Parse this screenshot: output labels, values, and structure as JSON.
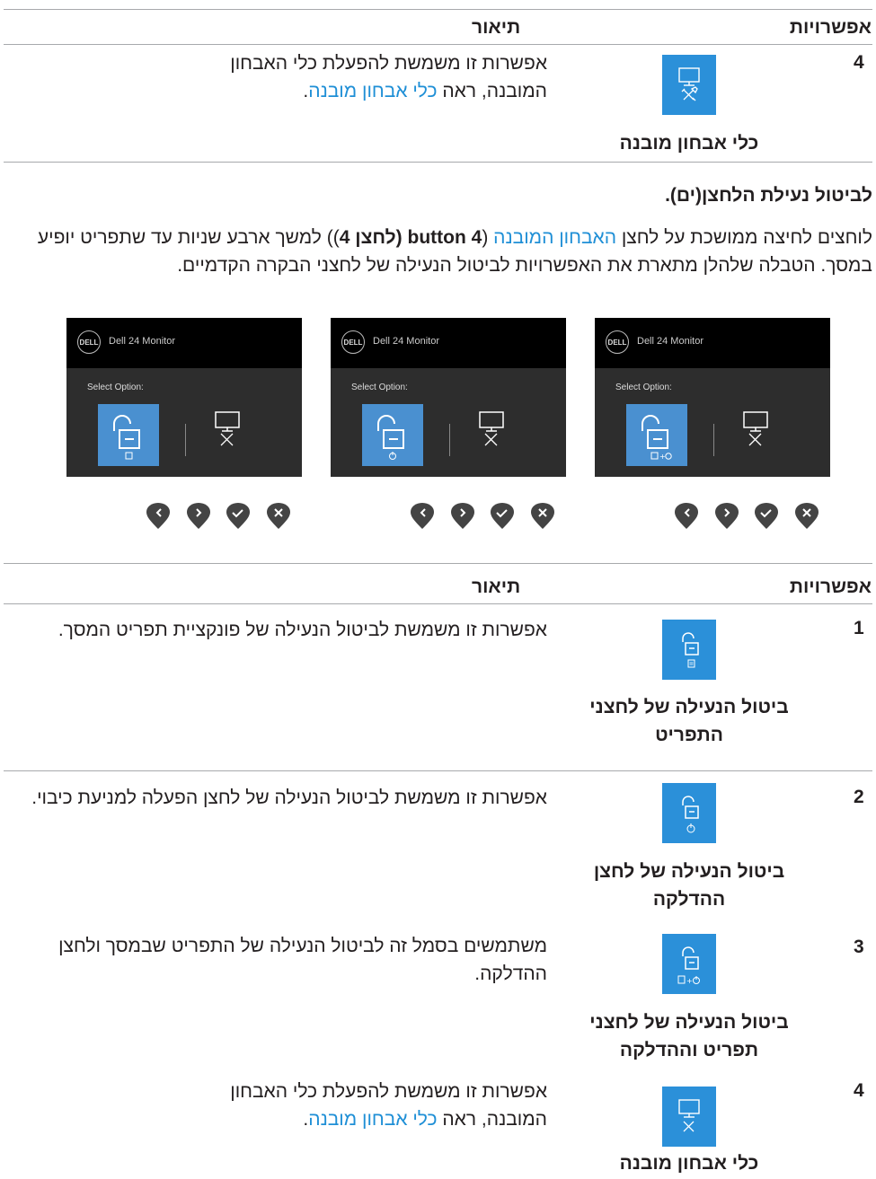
{
  "table1": {
    "col_options": "אפשרויות",
    "col_description": "תיאור",
    "rows": [
      {
        "num": "4",
        "icon": "monitor-tools-icon",
        "caption": "כלי אבחון מובנה",
        "desc_text": "אפשרות זו משמשת להפעלת כלי האבחון המובנה, ראה",
        "desc_link": "כלי אבחון מובנה",
        "desc_end": "."
      }
    ]
  },
  "section": {
    "heading": "לביטול נעילת הלחצן(ים).",
    "p_part1": "לוחצים לחיצה ממושכת על לחצן ",
    "p_link": "האבחון המובנה",
    "p_part2": " (",
    "p_bold": "button 4 (לחצן 4",
    "p_part3": ")) למשך ארבע שניות עד שתפריט יופיע במסך. הטבלה שלהלן מתארת את האפשרויות לביטול הנעילה של לחצני הבקרה הקדמיים."
  },
  "screens": [
    {
      "brand": "DELL",
      "model": "Dell 24 Monitor",
      "select": "Select Option:",
      "lock_variant": "menu"
    },
    {
      "brand": "DELL",
      "model": "Dell 24 Monitor",
      "select": "Select Option:",
      "lock_variant": "power"
    },
    {
      "brand": "DELL",
      "model": "Dell 24 Monitor",
      "select": "Select Option:",
      "lock_variant": "menu+power"
    }
  ],
  "nav_buttons": [
    "chevron-left-icon",
    "chevron-right-icon",
    "check-icon",
    "close-icon"
  ],
  "table2": {
    "col_options": "אפשרויות",
    "col_description": "תיאור",
    "rows": [
      {
        "num": "1",
        "icon": "unlock-menu-icon",
        "caption": "ביטול הנעילה של לחצני התפריט",
        "desc": "אפשרות זו משמשת לביטול הנעילה של פונקציית תפריט המסך."
      },
      {
        "num": "2",
        "icon": "unlock-power-icon",
        "caption": "ביטול הנעילה של לחצן ההדלקה",
        "desc": "אפשרות זו משמשת לביטול הנעילה של לחצן הפעלה למניעת כיבוי."
      },
      {
        "num": "3",
        "icon": "unlock-menu-power-icon",
        "caption": "ביטול הנעילה של לחצני תפריט וההדלקה",
        "desc": "משתמשים בסמל זה לביטול הנעילה של התפריט שבמסך ולחצן ההדלקה."
      },
      {
        "num": "4",
        "icon": "monitor-tools-icon",
        "caption": "כלי אבחון מובנה",
        "desc_text": "אפשרות זו משמשת להפעלת כלי האבחון המובנה, ראה",
        "desc_link": "כלי אבחון מובנה",
        "desc_end": "."
      }
    ]
  },
  "colors": {
    "accent": "#2b90d9",
    "link": "#1f8fd6",
    "rule": "#a7a9ac"
  }
}
